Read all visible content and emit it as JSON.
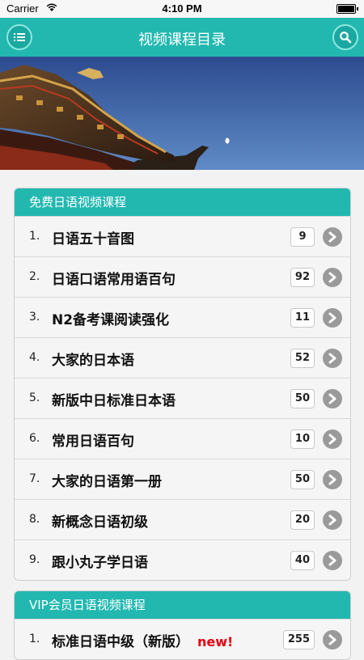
{
  "status": {
    "carrier": "Carrier",
    "time": "4:10 PM"
  },
  "nav": {
    "title": "视频课程目录",
    "menu_icon": "list-icon",
    "search_icon": "search-icon"
  },
  "free_section": {
    "title": "免费日语视频课程",
    "items": [
      {
        "num": "1.",
        "label": "日语五十音图",
        "count": "9"
      },
      {
        "num": "2.",
        "label": "日语口语常用语百句",
        "count": "92"
      },
      {
        "num": "3.",
        "label": "N2备考课阅读强化",
        "count": "11"
      },
      {
        "num": "4.",
        "label": "大家的日本语",
        "count": "52"
      },
      {
        "num": "5.",
        "label": "新版中日标准日本语",
        "count": "50"
      },
      {
        "num": "6.",
        "label": "常用日语百句",
        "count": "10"
      },
      {
        "num": "7.",
        "label": "大家的日语第一册",
        "count": "50"
      },
      {
        "num": "8.",
        "label": "新概念日语初级",
        "count": "20"
      },
      {
        "num": "9.",
        "label": "跟小丸子学日语",
        "count": "40"
      }
    ]
  },
  "vip_section": {
    "title": "VIP会员日语视频课程",
    "items": [
      {
        "num": "1.",
        "label": "标准日语中级（新版）",
        "tag": "new!",
        "count": "255"
      }
    ]
  },
  "colors": {
    "accent": "#22b8b0",
    "new_tag": "#e60012",
    "arrow": "#9a9a9a"
  }
}
